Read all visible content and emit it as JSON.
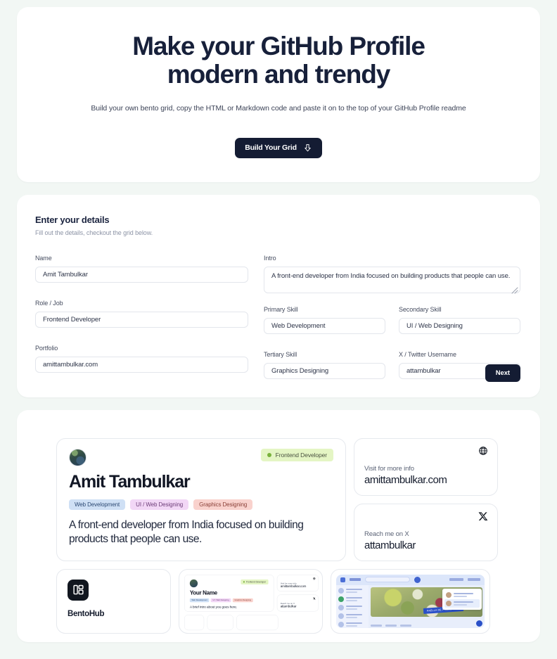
{
  "hero": {
    "title_line1": "Make your GitHub Profile",
    "title_line2": "modern and trendy",
    "subtitle": "Build your own bento grid, copy the HTML or Markdown code and paste it on to the top of your GitHub Profile readme",
    "cta_label": "Build Your Grid"
  },
  "form": {
    "title": "Enter your details",
    "subtitle": "Fill out the details, checkout the grid below.",
    "next_label": "Next",
    "fields": {
      "name": {
        "label": "Name",
        "value": "Amit Tambulkar"
      },
      "intro": {
        "label": "Intro",
        "value": "A front-end developer from India focused on building products that people can use."
      },
      "role": {
        "label": "Role / Job",
        "value": "Frontend Developer"
      },
      "primary_skill": {
        "label": "Primary Skill",
        "value": "Web Development"
      },
      "secondary_skill": {
        "label": "Secondary Skill",
        "value": "UI / Web Designing"
      },
      "portfolio": {
        "label": "Portfolio",
        "value": "amittambulkar.com"
      },
      "tertiary_skill": {
        "label": "Tertiary Skill",
        "value": "Graphics Designing"
      },
      "twitter": {
        "label": "X / Twitter Username",
        "value": "attambulkar"
      }
    }
  },
  "preview": {
    "profile": {
      "role_badge": "Frontend Developer",
      "name": "Amit Tambulkar",
      "tags": [
        {
          "label": "Web Development",
          "bg": "#cfe0f5",
          "fg": "#2d4a74"
        },
        {
          "label": "UI / Web Designing",
          "bg": "#f2d7f6",
          "fg": "#6d3d78"
        },
        {
          "label": "Graphics Designing",
          "bg": "#f9d2cd",
          "fg": "#8a4038"
        }
      ],
      "intro": "A front-end developer from India focused on building products that people can use."
    },
    "website_cell": {
      "kicker": "Visit for more info",
      "value": "amittambulkar.com",
      "icon": "globe-icon"
    },
    "x_cell": {
      "kicker": "Reach me on X",
      "value": "attambulkar",
      "icon": "x-logo-icon"
    },
    "brand_cell": {
      "name": "BentoHub",
      "icon": "bentohub-logo-icon"
    },
    "mini_preview": {
      "badge": "Frontend Developer",
      "name": "Your Name",
      "tags": [
        {
          "label": "Web Development",
          "bg": "#cfe0f5",
          "fg": "#2d4a74"
        },
        {
          "label": "UI / Web Designing",
          "bg": "#f2d7f6",
          "fg": "#6d3d78"
        },
        {
          "label": "Graphics Designing",
          "bg": "#f9d2cd",
          "fg": "#8a4038"
        }
      ],
      "intro": "A brief intro about you goes here.",
      "website_kicker": "Visit for more info",
      "website_value": "amittambulkar.com",
      "x_kicker": "Reach me on X",
      "x_value": "attambulkar"
    },
    "app_screenshot": {
      "ribbon": "PAELLA DE PRESO RICO"
    }
  },
  "colors": {
    "page_bg": "#f2f7f4",
    "card_bg": "#ffffff",
    "ink": "#17203a",
    "button_dark": "#141c33",
    "badge_green_bg": "#e4f5c4",
    "badge_green_dot": "#79b23c"
  }
}
